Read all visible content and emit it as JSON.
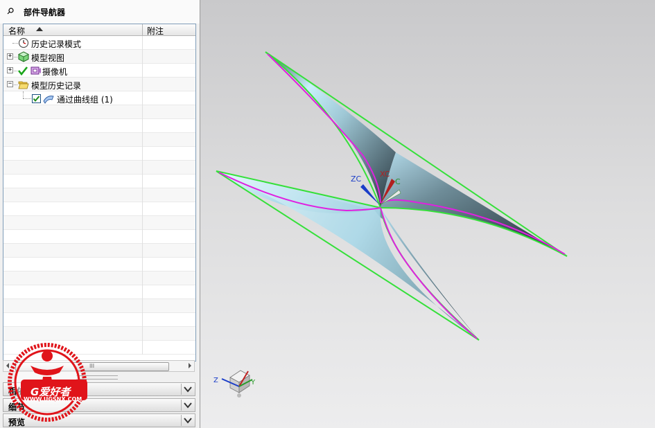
{
  "navigator": {
    "title": "部件导航器",
    "columns": {
      "name": "名称",
      "note": "附注"
    },
    "items": [
      {
        "label": "历史记录模式",
        "icon": "clock-icon"
      },
      {
        "label": "模型视图",
        "icon": "model-view-icon"
      },
      {
        "label": "摄像机",
        "icon": "camera-icon"
      },
      {
        "label": "模型历史记录",
        "icon": "folder-open-icon"
      },
      {
        "label": "通过曲线组 (1)",
        "icon": "through-curves-icon",
        "checked": true
      }
    ],
    "scroll_grip": "III"
  },
  "sections": [
    {
      "label": "相依性"
    },
    {
      "label": "细节"
    },
    {
      "label": "预览"
    }
  ],
  "watermark": {
    "text": "G爱好者",
    "url": "WWW.UGSNX.COM"
  },
  "viewport": {
    "datum_labels": {
      "zc": "ZC",
      "xc": "XC",
      "yc": "C"
    },
    "triad_labels": {
      "z": "Z",
      "y": "Y"
    },
    "colors": {
      "edge": "#35e03a",
      "curve": "#e020e0",
      "surface_light": "#c8f0fa",
      "surface_dark": "#2e3e48"
    }
  }
}
